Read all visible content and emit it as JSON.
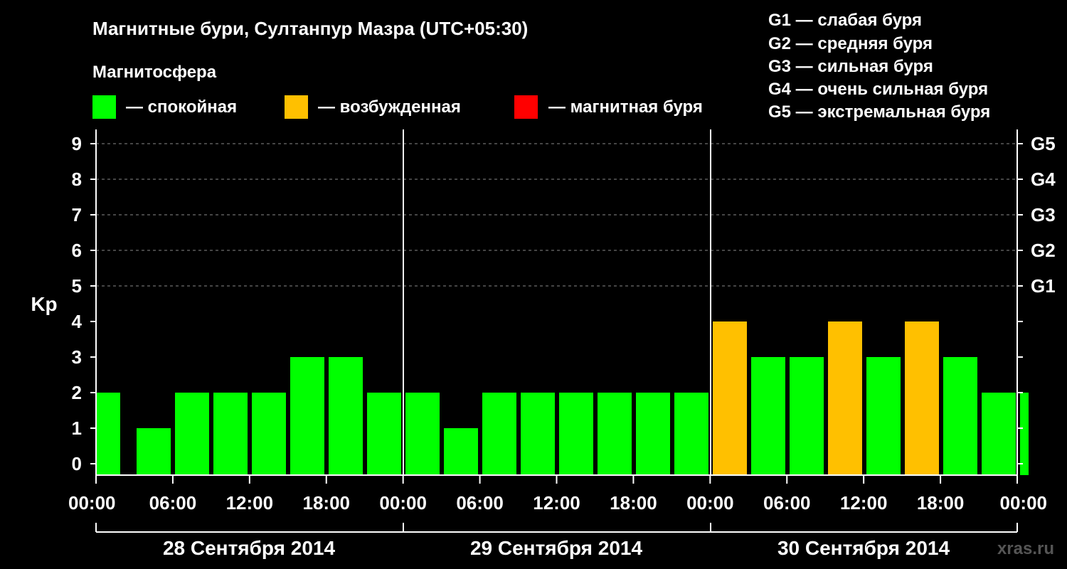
{
  "chart_data": {
    "type": "bar",
    "title": "Магнитные бури, Султанпур Мазра (UTC+05:30)",
    "ylabel": "Kp",
    "ylim": [
      0,
      9
    ],
    "y_ticks": [
      "0",
      "1",
      "2",
      "3",
      "4",
      "5",
      "6",
      "7",
      "8",
      "9"
    ],
    "g_scale": [
      "G1",
      "G2",
      "G3",
      "G4",
      "G5"
    ],
    "legend": {
      "title": "Магнитосфера",
      "items": [
        {
          "label": "— спокойная",
          "color": "#00ff00"
        },
        {
          "label": "— возбужденная",
          "color": "#ffc000"
        },
        {
          "label": "— магнитная буря",
          "color": "#ff0000"
        }
      ],
      "g_legend": [
        "G1 — слабая буря",
        "G2 — средняя буря",
        "G3 — сильная буря",
        "G4 — очень сильная буря",
        "G5 — экстремальная буря"
      ]
    },
    "x_ticks": [
      "00:00",
      "06:00",
      "12:00",
      "18:00",
      "00:00",
      "06:00",
      "12:00",
      "18:00",
      "00:00",
      "06:00",
      "12:00",
      "18:00",
      "00:00"
    ],
    "days": [
      "28 Сентября 2014",
      "29 Сентября 2014",
      "30 Сентября 2014"
    ],
    "values": [
      2,
      1,
      2,
      2,
      2,
      3,
      3,
      2,
      2,
      1,
      2,
      2,
      2,
      2,
      2,
      2,
      4,
      3,
      3,
      4,
      3,
      4,
      3,
      2,
      2
    ],
    "colors": {
      "quiet": "#00ff00",
      "active": "#ffc000",
      "storm": "#ff0000"
    },
    "watermark": "xras.ru"
  }
}
